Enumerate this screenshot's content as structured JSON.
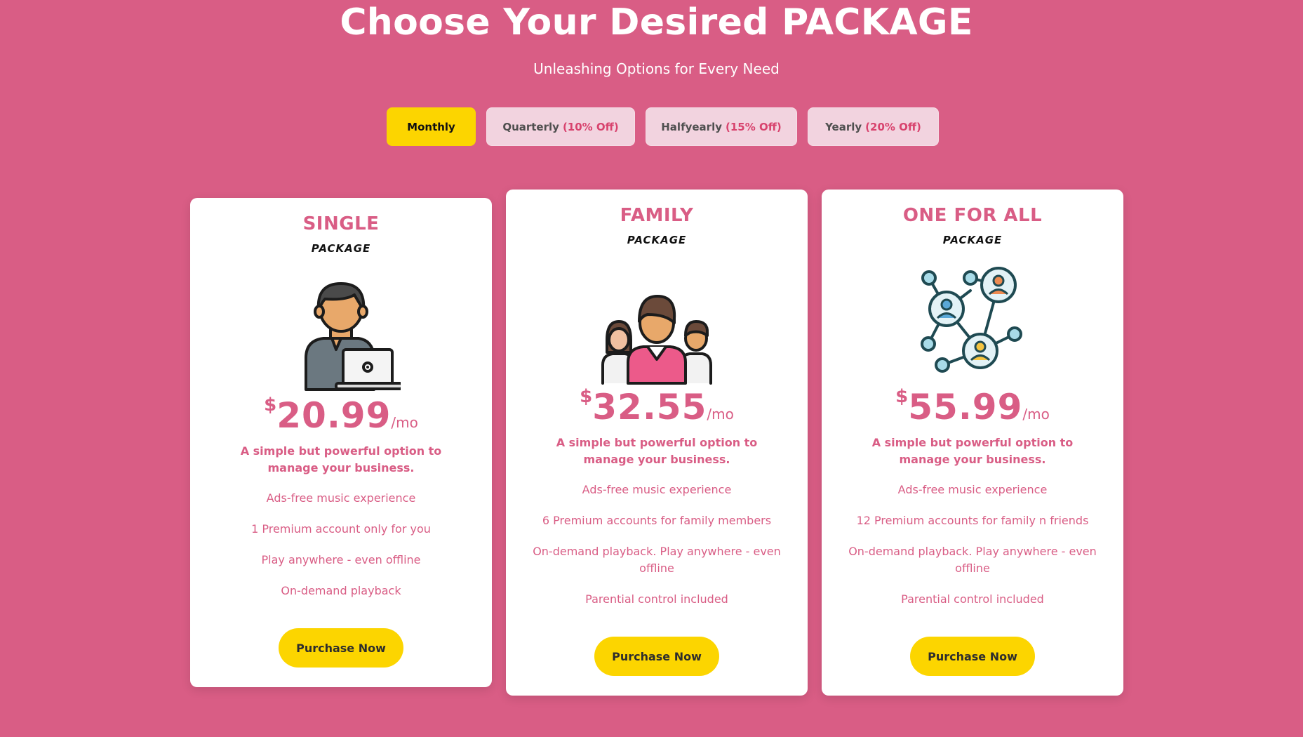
{
  "header": {
    "title": "Choose Your Desired PACKAGE",
    "subtitle": "Unleashing Options for Every Need"
  },
  "billing_tabs": [
    {
      "label": "Monthly",
      "discount": "",
      "active": true
    },
    {
      "label": "Quarterly",
      "discount": "(10% Off)",
      "active": false
    },
    {
      "label": "Halfyearly",
      "discount": "(15% Off)",
      "active": false
    },
    {
      "label": "Yearly",
      "discount": "(20% Off)",
      "active": false
    }
  ],
  "plans": [
    {
      "name": "SINGLE",
      "subtitle": "PACKAGE",
      "icon": "person-laptop-icon",
      "currency": "$",
      "price": "20.99",
      "period": "/mo",
      "description": "A simple but powerful option to manage your business.",
      "features": [
        "Ads-free music experience",
        "1 Premium account only for you",
        "Play anywhere - even offline",
        "On-demand playback"
      ],
      "button": "Purchase Now"
    },
    {
      "name": "FAMILY",
      "subtitle": "PACKAGE",
      "icon": "family-group-icon",
      "currency": "$",
      "price": "32.55",
      "period": "/mo",
      "description": "A simple but powerful option to manage your business.",
      "features": [
        "Ads-free music experience",
        "6 Premium accounts for family members",
        "On-demand playback. Play anywhere - even offline",
        "Parential control included"
      ],
      "button": "Purchase Now"
    },
    {
      "name": "ONE FOR ALL",
      "subtitle": "PACKAGE",
      "icon": "network-people-icon",
      "currency": "$",
      "price": "55.99",
      "period": "/mo",
      "description": "A simple but powerful option to manage your business.",
      "features": [
        "Ads-free music experience",
        "12 Premium accounts for family n friends",
        "On-demand playback. Play anywhere - even offline",
        "Parential control included"
      ],
      "button": "Purchase Now"
    }
  ],
  "colors": {
    "background": "#d95d85",
    "accent": "#fcd500",
    "tab_inactive": "#f2d3df",
    "discount": "#d8436e"
  }
}
